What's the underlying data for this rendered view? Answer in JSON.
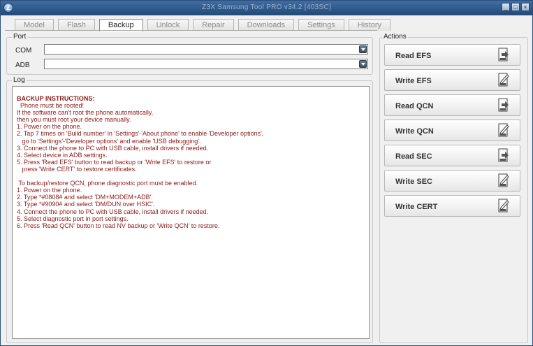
{
  "window": {
    "title": "Z3X Samsung Tool PRO v34.2 [403SC]"
  },
  "tabs": [
    {
      "label": "Model",
      "active": false
    },
    {
      "label": "Flash",
      "active": false
    },
    {
      "label": "Backup",
      "active": true
    },
    {
      "label": "Unlock",
      "active": false
    },
    {
      "label": "Repair",
      "active": false
    },
    {
      "label": "Downloads",
      "active": false
    },
    {
      "label": "Settings",
      "active": false
    },
    {
      "label": "History",
      "active": false
    }
  ],
  "port": {
    "group_label": "Port",
    "com_label": "COM",
    "com_value": "",
    "adb_label": "ADB",
    "adb_value": ""
  },
  "log": {
    "group_label": "Log",
    "lines": [
      "BACKUP INSTRUCTIONS:",
      "  Phone must be rooted!",
      "If the software can't root the phone automatically,",
      "then you must root your device manually.",
      "1. Power on the phone.",
      "2. Tap 7 times on 'Build number' in 'Settings'-'About phone' to enable 'Developer options',",
      "   go to 'Settings'-'Developer options' and enable 'USB debugging'.",
      "3. Connect the phone to PC with USB cable, install drivers if needed.",
      "4. Select device in ADB settings.",
      "5. Press 'Read EFS' button to read backup or 'Write EFS' to restore or",
      "   press 'Write CERT' to restore certificates.",
      "",
      " To backup/restore QCN, phone diagnostic port must be enabled.",
      "1. Power on the phone.",
      "2. Type *#0808# and select 'DM+MODEM+ADB'.",
      "3. Type *#9090# and select 'DM/DUN over HSIC'.",
      "4. Connect the phone to PC with USB cable, install drivers if needed.",
      "5. Select diagnostic port in port settings.",
      "6. Press 'Read QCN' button to read NV backup or 'Write QCN' to restore."
    ]
  },
  "actions": {
    "group_label": "Actions",
    "buttons": [
      {
        "label": "Read EFS",
        "icon": "read-icon",
        "tag": "EFS"
      },
      {
        "label": "Write EFS",
        "icon": "write-icon",
        "tag": "EFS"
      },
      {
        "label": "Read QCN",
        "icon": "read-icon",
        "tag": "QCN"
      },
      {
        "label": "Write QCN",
        "icon": "write-icon",
        "tag": "QCN"
      },
      {
        "label": "Read SEC",
        "icon": "read-icon",
        "tag": "SEC"
      },
      {
        "label": "Write SEC",
        "icon": "write-icon",
        "tag": "SEC"
      },
      {
        "label": "Write CERT",
        "icon": "write-icon",
        "tag": "CERT"
      }
    ]
  },
  "colors": {
    "titlebar": "#2f5b8f",
    "log_text": "#8b1a1a",
    "window_bg": "#f0f0f0"
  }
}
